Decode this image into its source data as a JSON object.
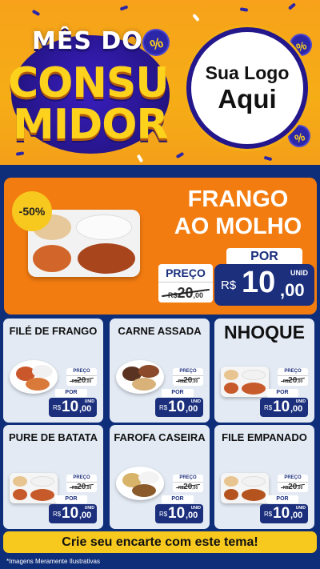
{
  "header": {
    "title_line1": "MÊS DO",
    "title_line2": "CONSU",
    "title_line3": "MIDOR",
    "percent_symbol": "%",
    "logo_line1": "Sua Logo",
    "logo_line2": "Aqui"
  },
  "colors": {
    "header_bg": "#f5ad16",
    "page_bg": "#0f2e7a",
    "hero_bg": "#f37c10",
    "card_bg": "#e3eaf4",
    "price_box": "#1b2f7d",
    "accent_yellow": "#f7c81e"
  },
  "hero": {
    "discount": "-50%",
    "title_line1": "FRANGO",
    "title_line2": "AO MOLHO",
    "por_label": "POR",
    "preco_label": "PREÇO",
    "old_currency": "R$",
    "old_int": "20",
    "old_dec": ",00",
    "new_currency": "R$",
    "new_int": "10",
    "new_dec": ",00",
    "unid": "UNID"
  },
  "cards": [
    {
      "title": "FILÉ DE FRANGO",
      "preco_label": "PREÇO",
      "old_currency": "R$",
      "old_int": "20",
      "old_dec": ",00",
      "por_label": "POR",
      "new_currency": "R$",
      "new_int": "10",
      "new_dec": ",00",
      "unid": "UNID"
    },
    {
      "title": "CARNE ASSADA",
      "preco_label": "PREÇO",
      "old_currency": "R$",
      "old_int": "20",
      "old_dec": ",00",
      "por_label": "POR",
      "new_currency": "R$",
      "new_int": "10",
      "new_dec": ",00",
      "unid": "UNID"
    },
    {
      "title": "NHOQUE",
      "preco_label": "PREÇO",
      "old_currency": "R$",
      "old_int": "20",
      "old_dec": ",00",
      "por_label": "POR",
      "new_currency": "R$",
      "new_int": "10",
      "new_dec": ",00",
      "unid": "UNID"
    },
    {
      "title": "PURE DE BATATA",
      "preco_label": "PREÇO",
      "old_currency": "R$",
      "old_int": "20",
      "old_dec": ",00",
      "por_label": "POR",
      "new_currency": "R$",
      "new_int": "10",
      "new_dec": ",00",
      "unid": "UNID"
    },
    {
      "title": "FAROFA CASEIRA",
      "preco_label": "PREÇO",
      "old_currency": "R$",
      "old_int": "20",
      "old_dec": ",00",
      "por_label": "POR",
      "new_currency": "R$",
      "new_int": "10",
      "new_dec": ",00",
      "unid": "UNID"
    },
    {
      "title": "FILE EMPANADO",
      "preco_label": "PREÇO",
      "old_currency": "R$",
      "old_int": "20",
      "old_dec": ",00",
      "por_label": "POR",
      "new_currency": "R$",
      "new_int": "10",
      "new_dec": ",00",
      "unid": "UNID"
    }
  ],
  "footer": {
    "cta": "Crie seu encarte com este tema!",
    "disclaimer": "*Imagens Meramente Ilustrativas"
  }
}
